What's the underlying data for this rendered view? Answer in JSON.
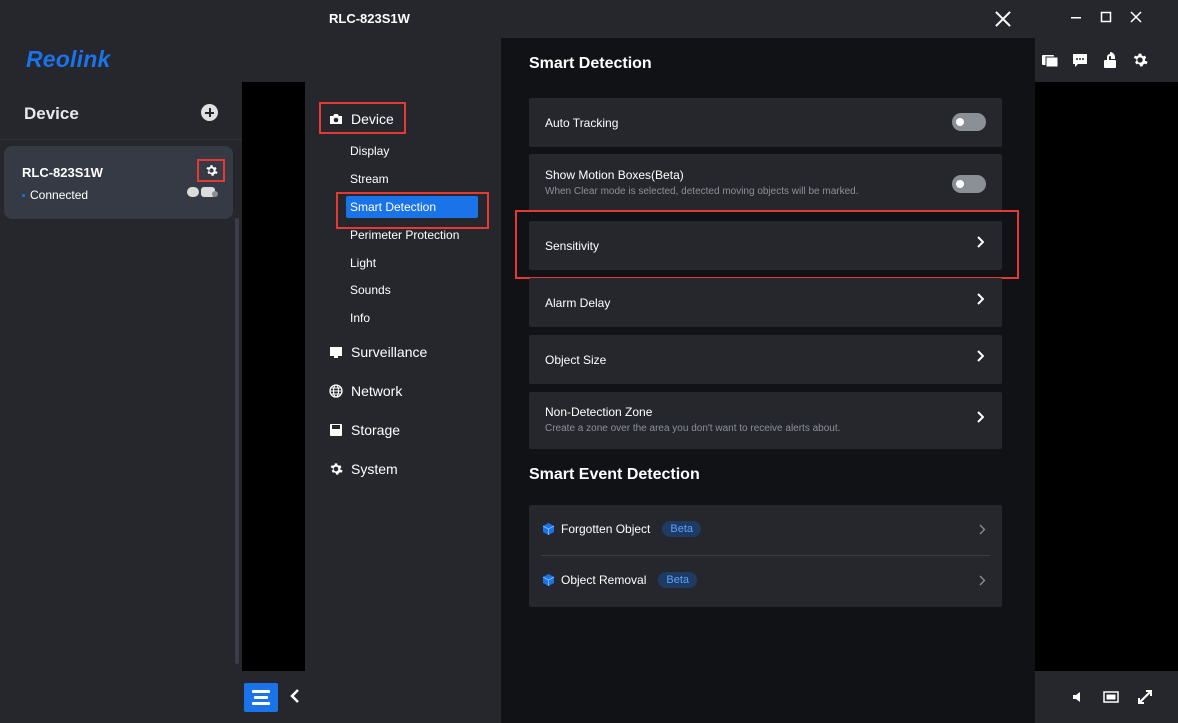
{
  "app": {
    "logo": "Reolink"
  },
  "left": {
    "title": "Device",
    "device": {
      "name": "RLC-823S1W",
      "status": "Connected"
    }
  },
  "modal": {
    "title": "RLC-823S1W",
    "nav": {
      "device": "Device",
      "sub": [
        "Display",
        "Stream",
        "Smart Detection",
        "Perimeter Protection",
        "Light",
        "Sounds",
        "Info"
      ],
      "surveillance": "Surveillance",
      "network": "Network",
      "storage": "Storage",
      "system": "System"
    },
    "smart_detection": {
      "title": "Smart Detection",
      "auto_tracking": "Auto Tracking",
      "show_motion": "Show Motion Boxes(Beta)",
      "show_motion_desc": "When Clear mode is selected, detected moving objects will be marked.",
      "sensitivity": "Sensitivity",
      "alarm_delay": "Alarm Delay",
      "object_size": "Object Size",
      "non_detection": "Non-Detection Zone",
      "non_detection_desc": "Create a zone over the area you don't want to receive alerts about."
    },
    "smart_event": {
      "title": "Smart Event Detection",
      "forgotten": "Forgotten Object",
      "removal": "Object Removal",
      "beta": "Beta"
    }
  },
  "colors": {
    "accent": "#1a73e8",
    "highlight": "#e53935"
  }
}
